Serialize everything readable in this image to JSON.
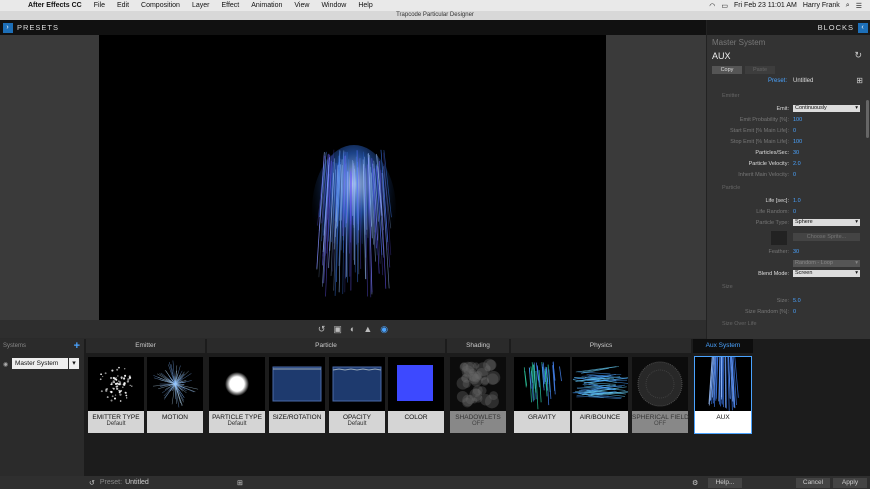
{
  "menubar": {
    "app": "After Effects CC",
    "items": [
      "File",
      "Edit",
      "Composition",
      "Layer",
      "Effect",
      "Animation",
      "View",
      "Window",
      "Help"
    ],
    "clock": "Fri Feb 23  11:01 AM",
    "user": "Harry Frank"
  },
  "window_title": "Trapcode Particular Designer",
  "presets_label": "PRESETS",
  "blocks_label": "BLOCKS",
  "right_panel": {
    "system_name": "Master System",
    "block_name": "AUX",
    "copy": "Copy",
    "paste": "Paste",
    "preset_key": "Preset:",
    "preset_value": "Untitled",
    "emitter_section": "Emitter",
    "emit_key": "Emit:",
    "emit_value": "Continuously",
    "emit_prob_key": "Emit Probability [%]:",
    "emit_prob_value": "100",
    "start_emit_key": "Start Emit [% Main Life]:",
    "start_emit_value": "0",
    "stop_emit_key": "Stop Emit [% Main Life]:",
    "stop_emit_value": "100",
    "pps_key": "Particles/Sec:",
    "pps_value": "30",
    "pvel_key": "Particle Velocity:",
    "pvel_value": "2.0",
    "inherit_key": "Inherit Main Velocity:",
    "inherit_value": "0",
    "particle_section": "Particle",
    "life_key": "Life [sec]:",
    "life_value": "1.0",
    "life_rand_key": "Life Random:",
    "life_rand_value": "0",
    "ptype_key": "Particle Type:",
    "ptype_value": "Sphere",
    "choose_sprite": "Choose Sprite...",
    "feather_key": "Feather:",
    "feather_value": "30",
    "random_loop": "Random - Loop",
    "blend_key": "Blend Mode:",
    "blend_value": "Screen",
    "size_section": "Size",
    "size_key": "Size:",
    "size_value": "5.0",
    "size_rand_key": "Size Random [%]:",
    "size_rand_value": "0",
    "size_over_life": "Size Over Life"
  },
  "systems": {
    "header": "Systems",
    "selected": "Master System"
  },
  "groups": {
    "emitter": "Emitter",
    "particle": "Particle",
    "shading": "Shading",
    "physics": "Physics",
    "aux": "Aux System"
  },
  "tiles": [
    {
      "name": "EMITTER TYPE",
      "sub": "Default"
    },
    {
      "name": "MOTION",
      "sub": ""
    },
    {
      "name": "PARTICLE TYPE",
      "sub": "Default"
    },
    {
      "name": "SIZE/ROTATION",
      "sub": ""
    },
    {
      "name": "OPACITY",
      "sub": "Default"
    },
    {
      "name": "COLOR",
      "sub": ""
    },
    {
      "name": "SHADOWLETS",
      "sub": "OFF"
    },
    {
      "name": "GRAVITY",
      "sub": ""
    },
    {
      "name": "AIR/BOUNCE",
      "sub": ""
    },
    {
      "name": "SPHERICAL FIELD",
      "sub": "OFF"
    },
    {
      "name": "AUX",
      "sub": ""
    }
  ],
  "statusbar": {
    "preset_key": "Preset:",
    "preset_value": "Untitled",
    "help": "Help...",
    "cancel": "Cancel",
    "apply": "Apply"
  },
  "colors": {
    "accent": "#4aa3ff",
    "panel": "#333333",
    "viewer": "#000000"
  }
}
